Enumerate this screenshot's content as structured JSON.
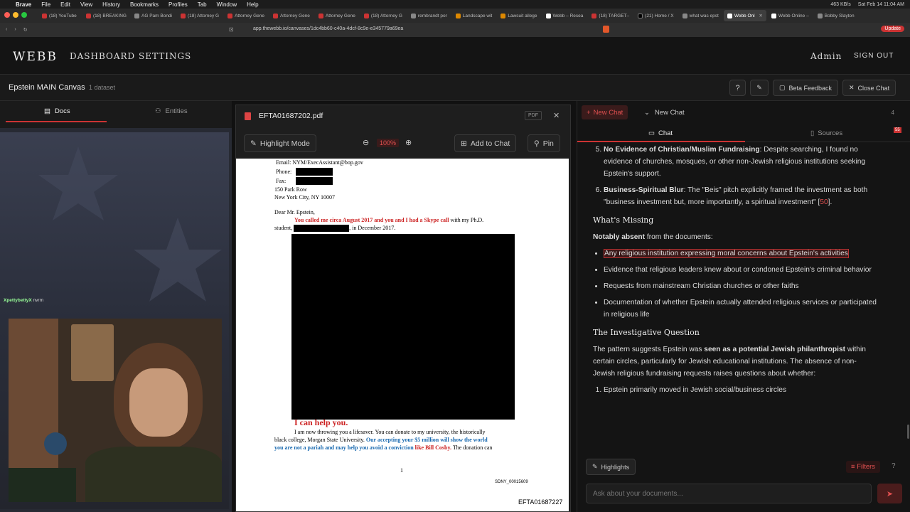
{
  "menubar": {
    "app": "Brave",
    "items": [
      "File",
      "Edit",
      "View",
      "History",
      "Bookmarks",
      "Profiles",
      "Tab",
      "Window",
      "Help"
    ],
    "clock": "Sat Feb 14  11:04 AM",
    "net": "463 KB/s"
  },
  "tabs": [
    "(18) YouTube",
    "(18) BREAKING",
    "AG Pam Bondi",
    "(18) Attorney G",
    "Attorney Gene",
    "Attorney Gene",
    "Attorney Gene",
    "(18) Attorney G",
    "rembrandt por",
    "Landscape wit",
    "Lawsuit allege",
    "Webb – Resea",
    "(18) TARGET–",
    "(21) Home / X",
    "what was epst",
    "Webb Onl",
    "Webb Online –",
    "Bobby Slayton"
  ],
  "address": {
    "url": "app.thewebb.io/canvases/1dc4bb60-c40a-4dcf-8c9e-e345779a69ea",
    "update_label": "Update"
  },
  "app": {
    "logo": "WEBB",
    "nav": [
      "DASHBOARD",
      "SETTINGS"
    ],
    "admin": "Admin",
    "signout": "SIGN OUT"
  },
  "canvas": {
    "title": "Epstein MAIN Canvas",
    "datasets": "1 dataset",
    "beta_feedback": "Beta Feedback",
    "close_chat": "Close Chat"
  },
  "left": {
    "tab_docs": "Docs",
    "tab_entities": "Entities",
    "chat_user": "XpettybettyX",
    "chat_msg": "nvrm"
  },
  "pdf": {
    "filename": "EFTA01687202.pdf",
    "badge": "PDF",
    "highlight_mode": "Highlight Mode",
    "zoom": "100%",
    "add_to_chat": "Add to Chat",
    "pin": "Pin",
    "email": "Email:  NYM/ExecAssistant@bop.gov",
    "phone": "Phone:",
    "fax": "Fax:",
    "addr1": "150 Park Row",
    "addr2": "New York City, NY  10007",
    "greeting": "Dear Mr. Epstein,",
    "l1_red": "You called me circa August 2017 and you and I had a Skype call",
    "l1_rest": " with my Ph.D.",
    "l2_a": "student, ",
    "l2_b": ", in December 2017.",
    "help": "I can help you.",
    "b1": "I am now throwing you a lifesaver.  You can donate to my university, the historically",
    "b2a": "black college, Morgan State University.  ",
    "b2b": "Our accepting your $5 million will show the world",
    "b3a": "you are not a pariah and may help you avoid a conviction ",
    "b3b": "like Bill Cosby.",
    "b3c": "  The donation can",
    "pagenum": "1",
    "sdny": "SDNY_00015609",
    "footer_id": "EFTA01687227"
  },
  "chat": {
    "new_chat_button": "New Chat",
    "new_chat_dropdown": "New Chat",
    "count": "4",
    "tab_chat": "Chat",
    "tab_sources": "Sources",
    "sources_badge": "55",
    "item5_title": "No Evidence of Christian/Muslim Fundraising",
    "item5_body": ": Despite searching, I found no evidence of churches, mosques, or other non-Jewish religious institutions seeking Epstein's support.",
    "item6_title": "Business-Spiritual Blur",
    "item6_body": ": The \"Beis\" pitch explicitly framed the investment as both \"business investment but, more importantly, a spiritual investment\" [",
    "item6_cite": "50",
    "item6_end": "].",
    "missing_heading": "What's Missing",
    "absent_bold": "Notably absent",
    "absent_rest": " from the documents:",
    "bullets": [
      "Any religious institution expressing moral concerns about Epstein's activities",
      "Evidence that religious leaders knew about or condoned Epstein's criminal behavior",
      "Requests from mainstream Christian churches or other faiths",
      "Documentation of whether Epstein actually attended religious services or participated in religious life"
    ],
    "question_heading": "The Investigative Question",
    "q_a": "The pattern suggests Epstein was ",
    "q_bold": "seen as a potential Jewish philanthropist",
    "q_b": " within certain circles, particularly for Jewish educational institutions. The absence of non-Jewish religious fundraising requests raises questions about whether:",
    "item1": "Epstein primarily moved in Jewish social/business circles",
    "highlights": "Highlights",
    "filters": "Filters",
    "placeholder": "Ask about your documents..."
  },
  "colors": {
    "accent": "#e05050",
    "bg": "#141414"
  }
}
